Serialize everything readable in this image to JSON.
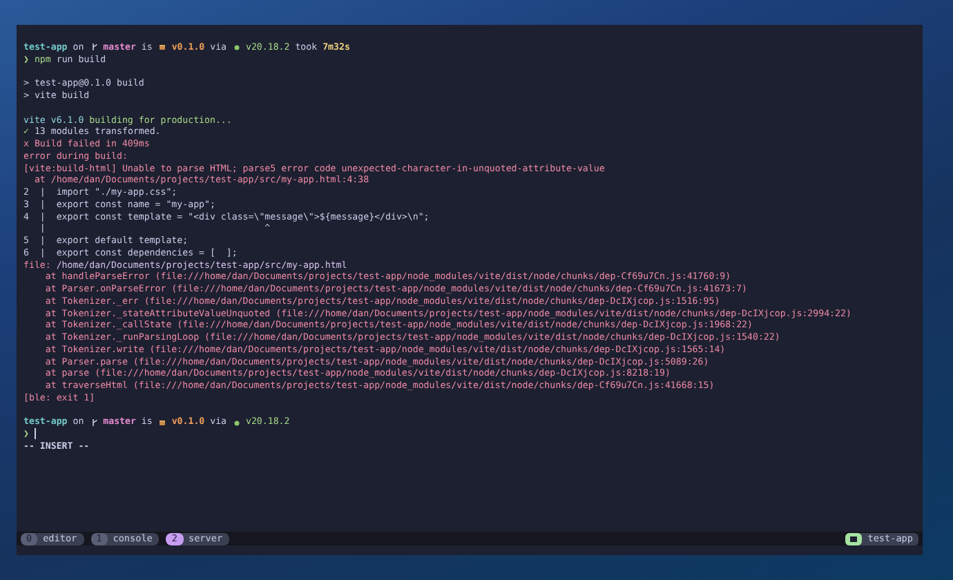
{
  "terminal": {
    "blocks": [
      [
        [
          {
            "kind": "dir",
            "text": "test-app"
          },
          {
            "kind": "plain",
            "text": " on "
          },
          {
            "kind": "branch-icon"
          },
          {
            "kind": "branch",
            "text": " master"
          },
          {
            "kind": "plain",
            "text": " is "
          },
          {
            "kind": "package-icon"
          },
          {
            "kind": "version",
            "text": " v0.1.0"
          },
          {
            "kind": "plain",
            "text": " via "
          },
          {
            "kind": "node-icon"
          },
          {
            "kind": "node",
            "text": " v20.18.2"
          },
          {
            "kind": "plain",
            "text": " took "
          },
          {
            "kind": "duration",
            "text": "7m32s"
          }
        ],
        [
          {
            "kind": "prompt",
            "text": "❯"
          },
          {
            "kind": "command",
            "text": " npm"
          },
          {
            "kind": "plain",
            "text": " run build"
          }
        ]
      ],
      [
        [
          {
            "kind": "plain",
            "text": "> test-app@0.1.0 build"
          }
        ],
        [
          {
            "kind": "plain",
            "text": "> vite build"
          }
        ]
      ],
      [
        [
          {
            "kind": "info",
            "text": "vite v6.1.0"
          },
          {
            "kind": "success",
            "text": " building for production..."
          }
        ],
        [
          {
            "kind": "success",
            "text": "✓"
          },
          {
            "kind": "plain",
            "text": " 13 modules transformed."
          }
        ],
        [
          {
            "kind": "error",
            "text": "x Build failed in 409ms"
          }
        ],
        [
          {
            "kind": "error",
            "text": "error during build:"
          }
        ],
        [
          {
            "kind": "error",
            "text": "[vite:build-html] Unable to parse HTML; parse5 error code unexpected-character-in-unquoted-attribute-value"
          }
        ],
        [
          {
            "kind": "error",
            "text": "  at /home/dan/Documents/projects/test-app/src/my-app.html:4:38"
          }
        ],
        [
          {
            "kind": "code",
            "text": "2  |  import \"./my-app.css\";"
          }
        ],
        [
          {
            "kind": "code",
            "text": "3  |  export const name = \"my-app\";"
          }
        ],
        [
          {
            "kind": "code",
            "text": "4  |  export const template = \"<div class=\\\"message\\\">${message}</div>\\n\";"
          }
        ],
        [
          {
            "kind": "code",
            "text": "   |                                        ^"
          }
        ],
        [
          {
            "kind": "code",
            "text": "5  |  export default template;"
          }
        ],
        [
          {
            "kind": "code",
            "text": "6  |  export const dependencies = [  ];"
          }
        ],
        [
          {
            "kind": "error",
            "text": "file:"
          },
          {
            "kind": "path",
            "text": " /home/dan/Documents/projects/test-app/src/my-app.html"
          }
        ],
        [
          {
            "kind": "error",
            "text": "    at handleParseError (file:///home/dan/Documents/projects/test-app/node_modules/vite/dist/node/chunks/dep-Cf69u7Cn.js:41760:9)"
          }
        ],
        [
          {
            "kind": "error",
            "text": "    at Parser.onParseError (file:///home/dan/Documents/projects/test-app/node_modules/vite/dist/node/chunks/dep-Cf69u7Cn.js:41673:7)"
          }
        ],
        [
          {
            "kind": "error",
            "text": "    at Tokenizer._err (file:///home/dan/Documents/projects/test-app/node_modules/vite/dist/node/chunks/dep-DcIXjcop.js:1516:95)"
          }
        ],
        [
          {
            "kind": "error",
            "text": "    at Tokenizer._stateAttributeValueUnquoted (file:///home/dan/Documents/projects/test-app/node_modules/vite/dist/node/chunks/dep-DcIXjcop.js:2994:22)"
          }
        ],
        [
          {
            "kind": "error",
            "text": "    at Tokenizer._callState (file:///home/dan/Documents/projects/test-app/node_modules/vite/dist/node/chunks/dep-DcIXjcop.js:1968:22)"
          }
        ],
        [
          {
            "kind": "error",
            "text": "    at Tokenizer._runParsingLoop (file:///home/dan/Documents/projects/test-app/node_modules/vite/dist/node/chunks/dep-DcIXjcop.js:1540:22)"
          }
        ],
        [
          {
            "kind": "error",
            "text": "    at Tokenizer.write (file:///home/dan/Documents/projects/test-app/node_modules/vite/dist/node/chunks/dep-DcIXjcop.js:1565:14)"
          }
        ],
        [
          {
            "kind": "error",
            "text": "    at Parser.parse (file:///home/dan/Documents/projects/test-app/node_modules/vite/dist/node/chunks/dep-DcIXjcop.js:5089:26)"
          }
        ],
        [
          {
            "kind": "error",
            "text": "    at parse (file:///home/dan/Documents/projects/test-app/node_modules/vite/dist/node/chunks/dep-DcIXjcop.js:8218:19)"
          }
        ],
        [
          {
            "kind": "error",
            "text": "    at traverseHtml (file:///home/dan/Documents/projects/test-app/node_modules/vite/dist/node/chunks/dep-Cf69u7Cn.js:41668:15)"
          }
        ],
        [
          {
            "kind": "error",
            "text": "[ble: exit 1]"
          }
        ]
      ],
      [
        [
          {
            "kind": "dir",
            "text": "test-app"
          },
          {
            "kind": "plain",
            "text": " on "
          },
          {
            "kind": "branch-icon"
          },
          {
            "kind": "branch",
            "text": " master"
          },
          {
            "kind": "plain",
            "text": " is "
          },
          {
            "kind": "package-icon"
          },
          {
            "kind": "version",
            "text": " v0.1.0"
          },
          {
            "kind": "plain",
            "text": " via "
          },
          {
            "kind": "node-icon"
          },
          {
            "kind": "node",
            "text": " v20.18.2"
          }
        ],
        [
          {
            "kind": "prompt",
            "text": "❯"
          },
          {
            "kind": "cursor"
          }
        ],
        [
          {
            "kind": "mode",
            "text": "-- INSERT --"
          }
        ]
      ]
    ]
  },
  "tmux": {
    "windows": [
      {
        "index": "0",
        "name": "editor",
        "selected": false
      },
      {
        "index": "1",
        "name": "console",
        "selected": false
      },
      {
        "index": "2",
        "name": "server",
        "selected": true
      }
    ],
    "session": {
      "name": "test-app"
    }
  }
}
